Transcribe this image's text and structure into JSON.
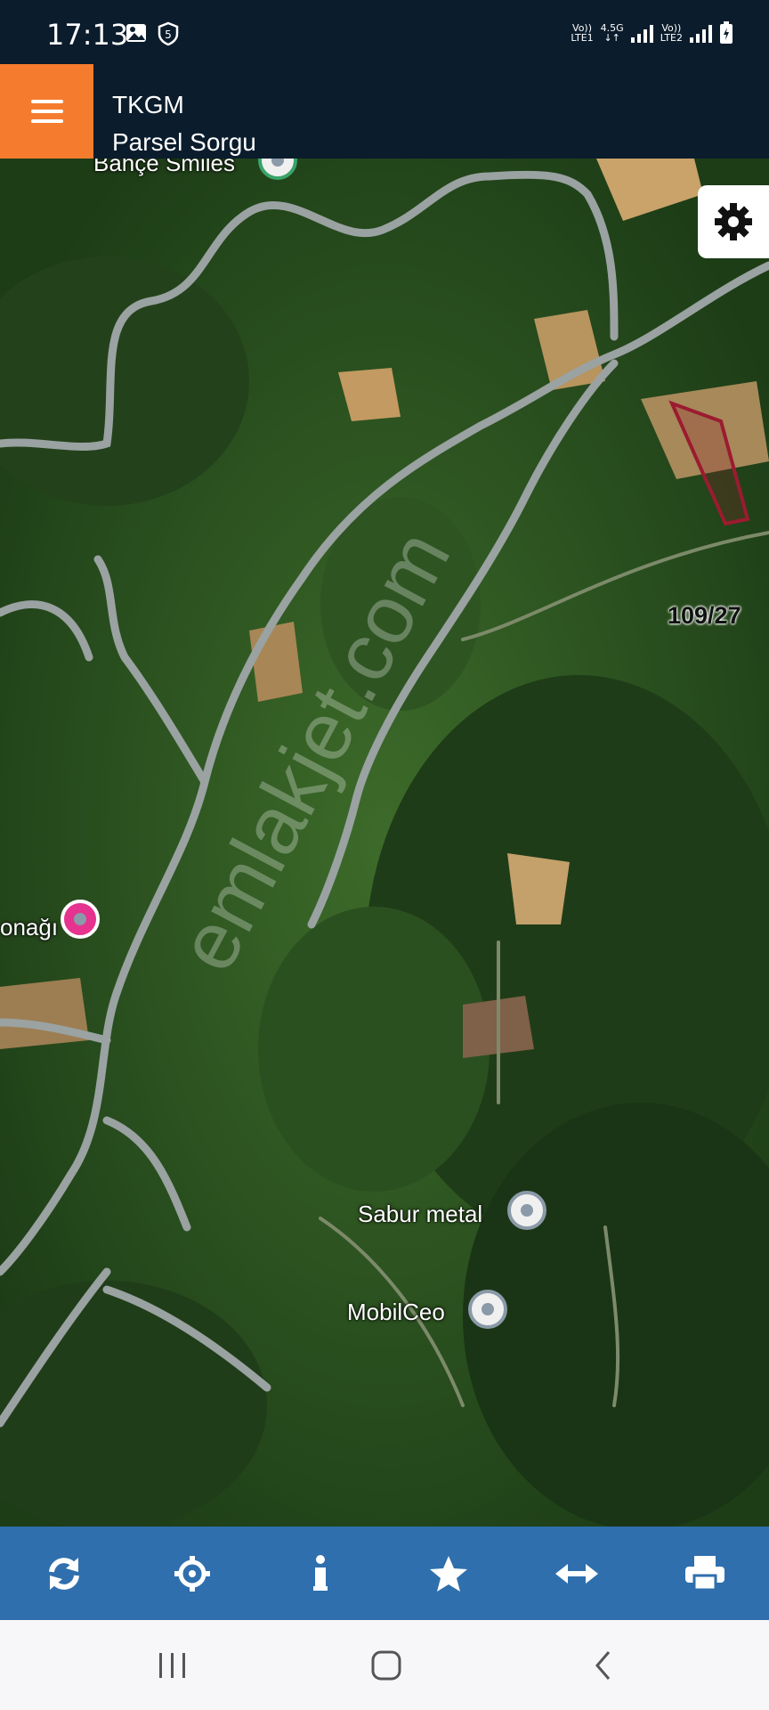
{
  "status_bar": {
    "time": "17:13",
    "sim1_net": "Vo))",
    "sim1_type": "LTE1",
    "sim1_speed": "4.5G",
    "sim2_net": "Vo))",
    "sim2_type": "LTE2",
    "left_icons": [
      "gallery-icon",
      "shield-5-icon"
    ]
  },
  "app_bar": {
    "title": "TKGM",
    "subtitle": "Parsel Sorgu",
    "menu_icon": "hamburger-icon",
    "accent": "#f57c2f",
    "background": "#0b1c2c"
  },
  "map": {
    "parcel_label": "109/27",
    "parcel_color": "#9b1b30",
    "poi_top": "Bahçe Smiles",
    "poi_left": "onağı",
    "poi_sabur": "Sabur metal",
    "poi_mobil": "MobilCeo",
    "watermark": "emlakjet.com",
    "settings_icon": "gear-icon"
  },
  "toolbar": {
    "background": "#2f6fad",
    "tools": [
      "refresh-icon",
      "locate-icon",
      "info-icon",
      "favorite-icon",
      "measure-icon",
      "print-icon"
    ]
  },
  "nav_bar": {
    "buttons": [
      "recent-apps-icon",
      "home-icon",
      "back-icon"
    ]
  }
}
